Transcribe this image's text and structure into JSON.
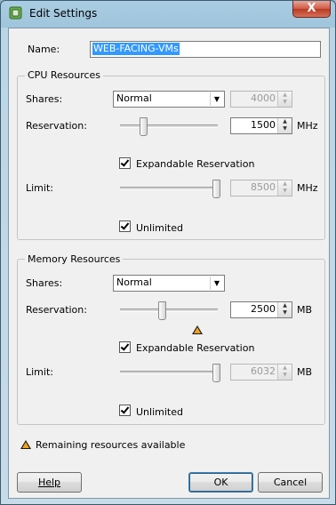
{
  "window": {
    "title": "Edit Settings",
    "close_label": "X"
  },
  "name": {
    "label": "Name:",
    "value": "WEB-FACING-VMs"
  },
  "cpu": {
    "legend": "CPU Resources",
    "shares": {
      "label": "Shares:",
      "selected": "Normal",
      "value": "4000"
    },
    "reservation": {
      "label": "Reservation:",
      "value": "1500",
      "unit": "MHz",
      "slider_fraction": 0.23
    },
    "expandable": {
      "label": "Expandable Reservation",
      "checked": true
    },
    "limit": {
      "label": "Limit:",
      "value": "8500",
      "unit": "MHz",
      "slider_fraction": 1.0
    },
    "unlimited": {
      "label": "Unlimited",
      "checked": true
    }
  },
  "memory": {
    "legend": "Memory Resources",
    "shares": {
      "label": "Shares:",
      "selected": "Normal"
    },
    "reservation": {
      "label": "Reservation:",
      "value": "2500",
      "unit": "MB",
      "slider_fraction": 0.43
    },
    "expandable": {
      "label": "Expandable Reservation",
      "checked": true
    },
    "limit": {
      "label": "Limit:",
      "value": "6032",
      "unit": "MB",
      "slider_fraction": 1.0
    },
    "unlimited": {
      "label": "Unlimited",
      "checked": true
    }
  },
  "footer": {
    "legend_text": "Remaining resources available",
    "help_label": "Help",
    "ok_label": "OK",
    "cancel_label": "Cancel"
  },
  "colors": {
    "accent": "#3399ff",
    "warning": "#f0a020",
    "close": "#c84530"
  }
}
